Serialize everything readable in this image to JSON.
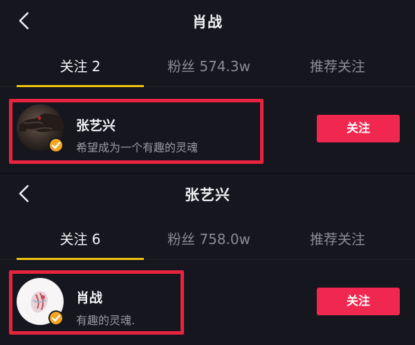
{
  "screens": [
    {
      "title": "肖战",
      "tabs": {
        "following": "关注 2",
        "fans": "粉丝 574.3w",
        "recommended": "推荐关注"
      },
      "user": {
        "name": "张艺兴",
        "bio": "希望成为一个有趣的灵魂",
        "follow_label": "关注"
      }
    },
    {
      "title": "张艺兴",
      "tabs": {
        "following": "关注 6",
        "fans": "粉丝 758.0w",
        "recommended": "推荐关注"
      },
      "user": {
        "name": "肖战",
        "bio": "有趣的灵魂.",
        "follow_label": "关注"
      }
    }
  ],
  "colors": {
    "background": "#15161e",
    "accent_tab": "#f1c40f",
    "follow_button": "#f02850",
    "highlight_box": "#e8233f",
    "verified_badge": "#f5a623"
  },
  "icons": {
    "back": "chevron-left-icon",
    "verified": "verified-check-icon"
  }
}
